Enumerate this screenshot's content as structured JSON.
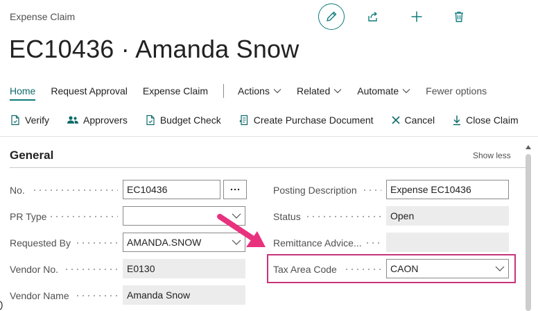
{
  "header": {
    "page_type": "Expense Claim",
    "title": "EC10436 · Amanda Snow",
    "icons": [
      "edit-icon",
      "share-icon",
      "add-icon",
      "delete-icon"
    ]
  },
  "action_bar": {
    "home": "Home",
    "request_approval": "Request Approval",
    "expense_claim": "Expense Claim",
    "actions": "Actions",
    "related": "Related",
    "automate": "Automate",
    "fewer_options": "Fewer options"
  },
  "toolbar": {
    "verify": "Verify",
    "approvers": "Approvers",
    "budget_check": "Budget Check",
    "create_purchase_document": "Create Purchase Document",
    "cancel": "Cancel",
    "close_claim": "Close Claim"
  },
  "general": {
    "title": "General",
    "show_less": "Show less",
    "fields": {
      "no": {
        "label": "No.",
        "value": "EC10436"
      },
      "pr_type": {
        "label": "PR Type",
        "value": ""
      },
      "requested_by": {
        "label": "Requested By",
        "value": "AMANDA.SNOW"
      },
      "vendor_no": {
        "label": "Vendor No.",
        "value": "E0130"
      },
      "vendor_name": {
        "label": "Vendor Name",
        "value": "Amanda Snow"
      },
      "posting_description": {
        "label": "Posting Description",
        "value": "Expense EC10436"
      },
      "status": {
        "label": "Status",
        "value": "Open"
      },
      "remittance_advice": {
        "label": "Remittance Advice...",
        "value": ""
      },
      "tax_area_code": {
        "label": "Tax Area Code",
        "value": "CAON"
      }
    }
  },
  "colors": {
    "accent": "#0f7b7b",
    "highlight": "#c7347a",
    "arrow": "#e8327e"
  }
}
